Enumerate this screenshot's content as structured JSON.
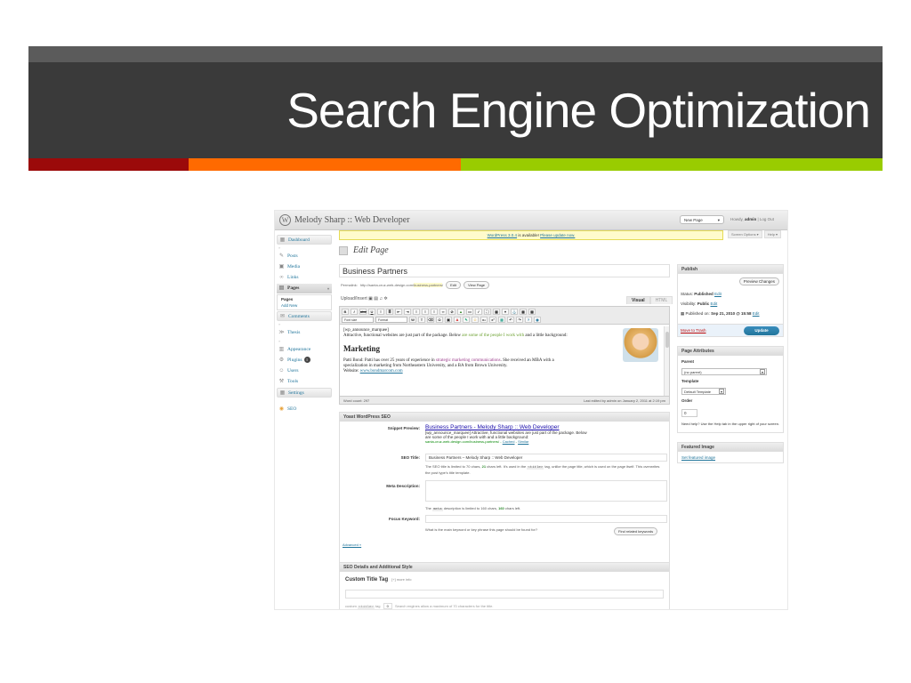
{
  "slide": {
    "title": "Search Engine Optimization",
    "colors": {
      "title_bg": "#3a3a3a",
      "stripe_red": "#9b0a0a",
      "stripe_orange": "#ff6a00",
      "stripe_green": "#99cc00"
    }
  },
  "wp": {
    "site_name": "Melody Sharp :: Web Developer",
    "new_page": "New Page",
    "howdy_prefix": "Howdy,",
    "howdy_user": "admin",
    "logout": "| Log Out",
    "nag_version": "WordPress 3.0.4",
    "nag_mid": " is available! ",
    "nag_link": "Please update now.",
    "screen_options": "Screen Options ▾",
    "help": "Help ▾",
    "menu": {
      "dashboard": "Dashboard",
      "posts": "Posts",
      "media": "Media",
      "links": "Links",
      "pages": "Pages",
      "sub_pages": "Pages",
      "sub_add_new": "Add New",
      "comments": "Comments",
      "thesis": "Thesis",
      "appearance": "Appearance",
      "plugins": "Plugins",
      "plugins_count": "1",
      "users": "Users",
      "tools": "Tools",
      "settings": "Settings",
      "seo": "SEO"
    },
    "page_title": "Edit Page",
    "post_title": "Business Partners",
    "permalink_label": "Permalink:",
    "permalink_base": "http://santa-cruz-web-design.com/",
    "permalink_slug": "business-partners",
    "permalink_end": "/",
    "edit_btn": "Edit",
    "view_page_btn": "View Page",
    "upload_insert": "Upload/Insert",
    "tab_visual": "Visual",
    "tab_html": "HTML",
    "font_size": "Font size",
    "format": "Format",
    "content": {
      "shortcode": "[wp_announce_marquee]",
      "intro_a": "Attractive, functional websites are just part of the package.  Below ",
      "intro_b": "are some of the people I work with",
      "intro_c": " and a little background:",
      "heading": "Marketing",
      "p1_a": "Patti Bond: Patti has over 25 years of experience in ",
      "p1_b": "strategic marketing communications",
      "p1_c": ". She received an MBA with a",
      "p1_d": "specialization in marketing from Northeastern University, and a BA from Brown University.",
      "website_label": "Website: ",
      "website_link": "www.bondmarcom.com"
    },
    "path": "Path:",
    "word_count": "Word count: 297",
    "last_edited": "Last edited by admin on January 2, 2011 at 2:19 pm",
    "seo": {
      "box_title": "Yoast WordPress SEO",
      "snippet_label": "Snippet Preview:",
      "snippet_title": "Business Partners - Melody Sharp :: Web Developer",
      "snippet_desc_1": "[wp_announce_marquee] Attractive, functional websites are just part of the package.  Below",
      "snippet_desc_2": "are some of the people I work with and a little background:",
      "snippet_url": "santa-cruz-web-design.com/business-partners/ - ",
      "snippet_cached": "Cached",
      "snippet_sep": " - ",
      "snippet_similar": "Similar",
      "seo_title_label": "SEO Title:",
      "seo_title_value": "Business Partners – Melody Sharp :: Web Developer",
      "seo_hint_a": "The SEO title is limited to 70 chars, ",
      "seo_hint_num": "21",
      "seo_hint_b": " chars left. It's used in the ",
      "seo_hint_code": "<title>",
      "seo_hint_c": " tag, unlike the page title, which is used on the page itself. This overwrites the post type's title template.",
      "meta_label": "Meta Description:",
      "meta_hint_a": "The ",
      "meta_hint_code": "meta",
      "meta_hint_b": " description is limited to 160 chars, ",
      "meta_hint_num": "160",
      "meta_hint_c": " chars left.",
      "focus_label": "Focus Keyword:",
      "focus_hint": "What is the main keyword or key phrase this page should be found for?",
      "find_btn": "Find related keywords",
      "advanced": "Advanced »"
    },
    "details": {
      "box_title": "SEO Details and Additional Style",
      "custom_title": "Custom Title Tag",
      "more_info": "[+] more info",
      "hint_a": "custom ",
      "hint_code": "<title>",
      "hint_b": " tag ",
      "hint_zero": "0",
      "hint_c": " Search engines allow a maximum of 70 characters for the title."
    },
    "publish": {
      "title": "Publish",
      "preview_btn": "Preview Changes",
      "status_label": "Status:",
      "status_value": "Published",
      "visibility_label": "Visibility:",
      "visibility_value": "Public",
      "published_label": "Published on:",
      "published_value": "Sep 21, 2010 @ 15:58",
      "edit": "Edit",
      "trash": "Move to Trash",
      "update_btn": "Update"
    },
    "attributes": {
      "title": "Page Attributes",
      "parent_label": "Parent",
      "parent_value": "(no parent)",
      "template_label": "Template",
      "template_value": "Default Template",
      "order_label": "Order",
      "order_value": "0",
      "help": "Need help? Use the Help tab in the upper right of your screen."
    },
    "featured": {
      "title": "Featured Image",
      "link": "Set featured image"
    }
  }
}
